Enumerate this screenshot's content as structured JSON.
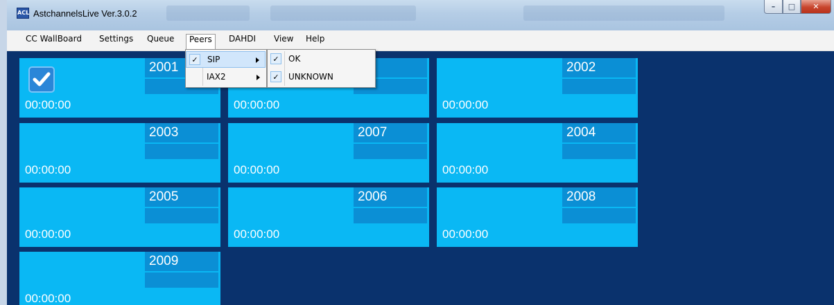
{
  "window": {
    "title": "AstchannelsLive Ver.3.0.2",
    "icon_text": "ACL",
    "controls": {
      "minimize": "–",
      "maximize": "□",
      "close": "✕"
    }
  },
  "menu": {
    "items": [
      "CC WallBoard",
      "Settings",
      "Queue",
      "Peers",
      "DAHDI",
      "View",
      "Help"
    ],
    "open_item": "Peers"
  },
  "peers_menu": {
    "items": [
      {
        "label": "SIP",
        "checked": true,
        "check": "✓",
        "has_submenu": true,
        "highlighted": true
      },
      {
        "label": "IAX2",
        "checked": false,
        "check": "",
        "has_submenu": true,
        "highlighted": false
      }
    ]
  },
  "sip_submenu": {
    "items": [
      {
        "label": "OK",
        "checked": true,
        "check": "✓"
      },
      {
        "label": "UNKNOWN",
        "checked": true,
        "check": "✓"
      }
    ]
  },
  "tiles": [
    {
      "number": "2001",
      "time": "00:00:00",
      "status_icon": "checkmark-icon",
      "checked": true
    },
    {
      "number": "2000",
      "number_visible": "00",
      "time": "00:00:00"
    },
    {
      "number": "2002",
      "time": "00:00:00"
    },
    {
      "number": "2003",
      "time": "00:00:00"
    },
    {
      "number": "2007",
      "time": "00:00:00"
    },
    {
      "number": "2004",
      "time": "00:00:00"
    },
    {
      "number": "2005",
      "time": "00:00:00"
    },
    {
      "number": "2006",
      "time": "00:00:00"
    },
    {
      "number": "2008",
      "time": "00:00:00"
    },
    {
      "number": "2009",
      "time": "00:00:00"
    }
  ],
  "colors": {
    "background": "#0a326d",
    "tile": "#0ab8f4",
    "tile_accent": "#0b8fd5",
    "text": "#ffffff"
  }
}
